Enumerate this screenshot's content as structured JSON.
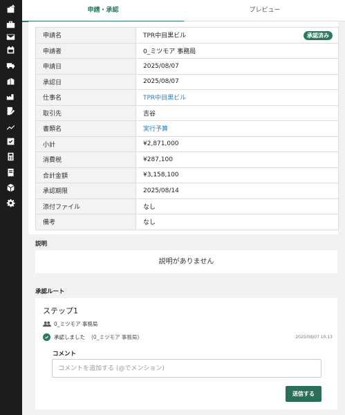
{
  "tabs": [
    {
      "label": "申請・承認"
    },
    {
      "label": "プレビュー"
    }
  ],
  "info_rows": [
    {
      "key": "申請名",
      "value": "TPR中目黒ビル",
      "badge": "承認済み"
    },
    {
      "key": "申請者",
      "value": "0_ミツモア 事務局"
    },
    {
      "key": "申請日",
      "value": "2025/08/07"
    },
    {
      "key": "承認日",
      "value": "2025/08/07"
    },
    {
      "key": "仕事名",
      "value": "TPR中目黒ビル"
    },
    {
      "key": "取引先",
      "value": "吉谷"
    },
    {
      "key": "書類名",
      "value": "実行予算"
    },
    {
      "key": "小計",
      "value": "¥2,871,000"
    },
    {
      "key": "消費税",
      "value": "¥287,100"
    },
    {
      "key": "合計金額",
      "value": "¥3,158,100"
    },
    {
      "key": "承認期限",
      "value": "2025/08/14"
    },
    {
      "key": "添付ファイル",
      "value": "なし"
    },
    {
      "key": "備考",
      "value": "なし"
    }
  ],
  "description": {
    "label": "説明",
    "empty_text": "説明がありません"
  },
  "route": {
    "label": "承認ルート",
    "step_title": "ステップ1",
    "group": "0_ミツモア 事務局",
    "status": "承認しました",
    "approved_by": "(0_ミツモア 事務局)",
    "timestamp": "2025/08/07 10:13",
    "comment_label": "コメント",
    "comment_placeholder": "コメントを追加する (@でメンション)",
    "send_label": "送信する"
  },
  "colors": {
    "accent": "#2b7a5b",
    "link": "#2a7dbf",
    "sidebar": "#1c1c1c"
  },
  "sidebar_icons": [
    "briefcase-plus-icon",
    "briefcase-icon",
    "mail-icon",
    "calendar-icon",
    "truck-icon",
    "building-icon",
    "factory-icon",
    "edit-document-icon",
    "trend-chart-icon",
    "checkbox-icon",
    "calculator-icon",
    "receipt-icon",
    "boxes-icon",
    "gear-icon"
  ]
}
